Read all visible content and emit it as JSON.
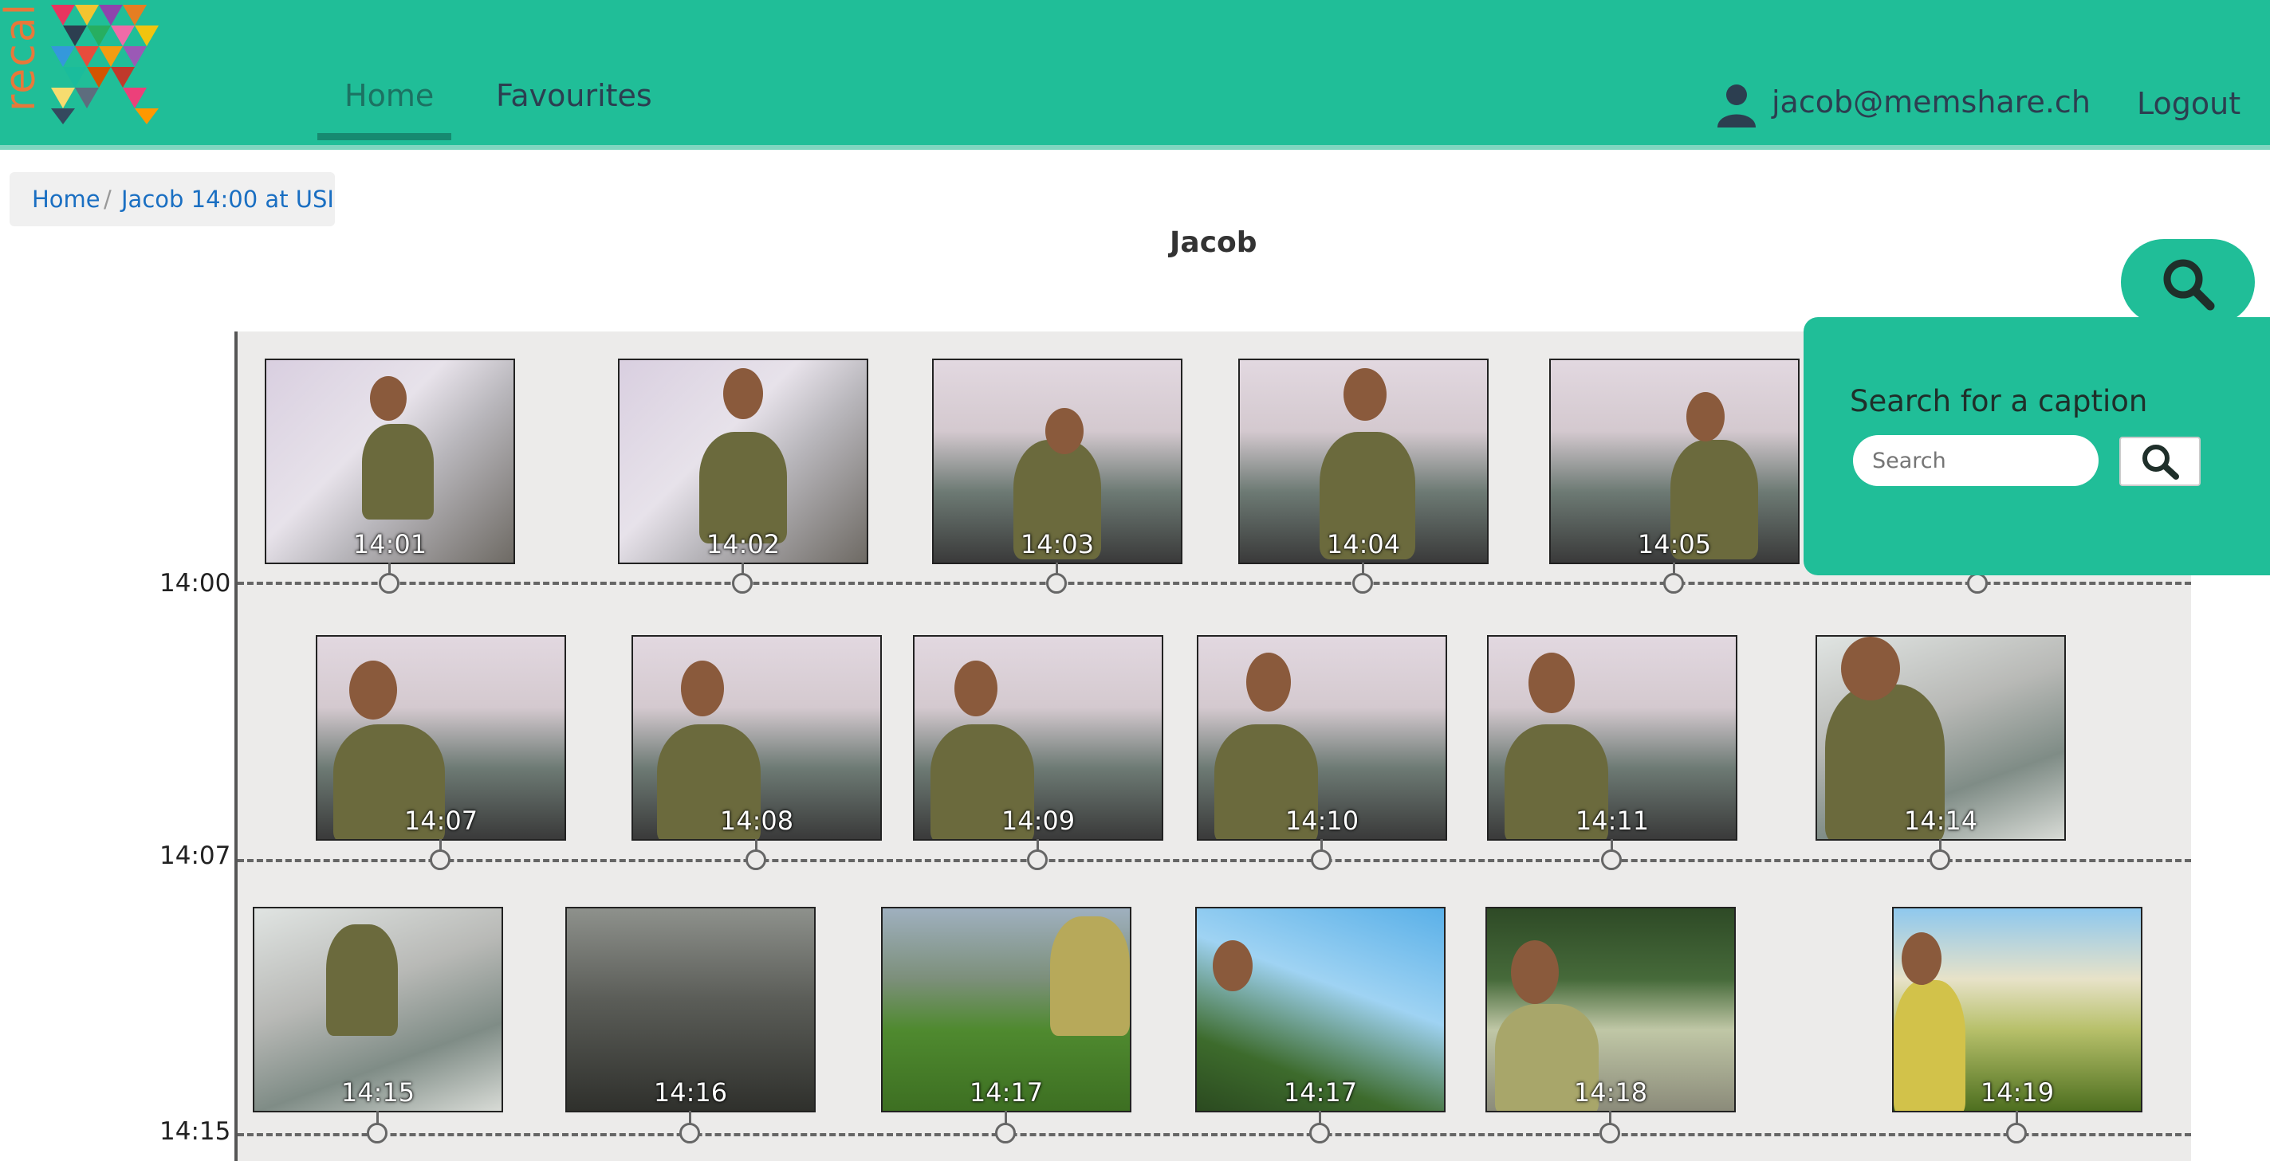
{
  "brand": {
    "word": "recall"
  },
  "nav": {
    "home": "Home",
    "favourites": "Favourites"
  },
  "user": {
    "email": "jacob@memshare.ch",
    "logout": "Logout"
  },
  "breadcrumb": {
    "items": [
      "Home",
      "Jacob 14:00 at USI"
    ],
    "separator": "/"
  },
  "page": {
    "title": "Jacob"
  },
  "search": {
    "title": "Search for a caption",
    "placeholder": "Search"
  },
  "timeline": {
    "rows": [
      {
        "label": "14:00",
        "photos": [
          "14:01",
          "14:02",
          "14:03",
          "14:04",
          "14:05"
        ]
      },
      {
        "label": "14:07",
        "photos": [
          "14:07",
          "14:08",
          "14:09",
          "14:10",
          "14:11",
          "14:14"
        ]
      },
      {
        "label": "14:15",
        "photos": [
          "14:15",
          "14:16",
          "14:17",
          "14:17",
          "14:18",
          "14:19"
        ]
      }
    ]
  },
  "colors": {
    "header": "#20be98",
    "accent": "#168a70",
    "link": "#1a6fc2"
  },
  "icons": [
    "user-icon",
    "search-icon"
  ]
}
